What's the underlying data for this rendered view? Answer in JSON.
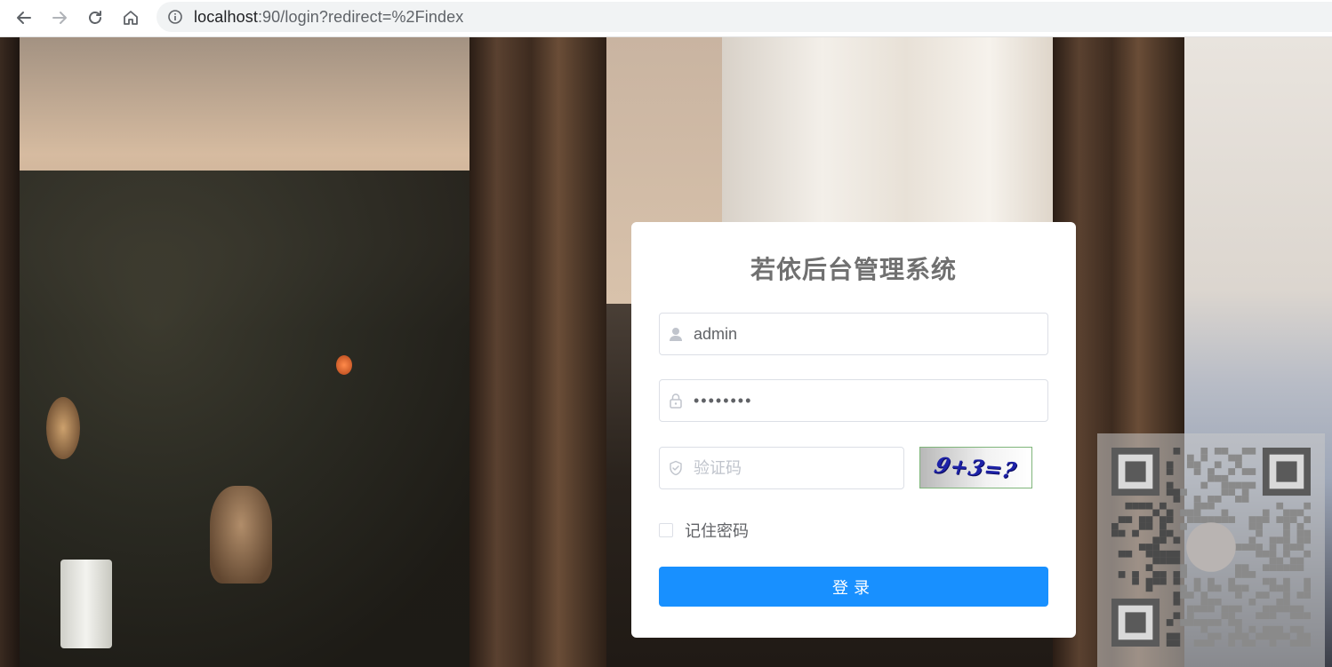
{
  "browser": {
    "url_host": "localhost",
    "url_rest": ":90/login?redirect=%2Findex",
    "icons": [
      "back-arrow-icon",
      "forward-arrow-icon",
      "reload-icon",
      "home-icon",
      "info-icon"
    ]
  },
  "login": {
    "title": "若依后台管理系统",
    "username_value": "admin",
    "password_value": "••••••••",
    "code_placeholder": "验证码",
    "captcha_text": "9+3=?",
    "remember_label": "记住密码",
    "remember_checked": false,
    "submit_label": "登录"
  },
  "colors": {
    "primary": "#1890ff",
    "title": "#707070",
    "border": "#dcdfe6"
  }
}
